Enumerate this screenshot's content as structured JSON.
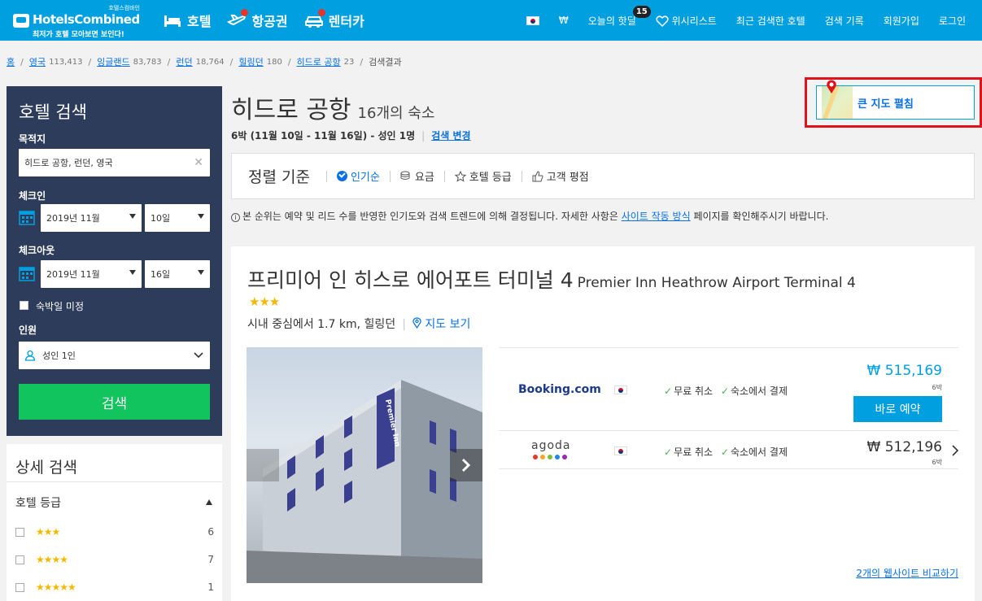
{
  "header": {
    "logo_tag": "호텔스컴바인",
    "logo_name": "HotelsCombined",
    "logo_slogan": "최저가 호텔 모아보면 보인다!",
    "nav": [
      {
        "label": "호텔",
        "icon": "bed-icon"
      },
      {
        "label": "항공권",
        "icon": "plane-icon"
      },
      {
        "label": "렌터카",
        "icon": "car-icon"
      }
    ],
    "currency": "₩",
    "deals_label": "오늘의 핫딜",
    "deals_count": "15",
    "wishlist": "위시리스트",
    "recent": "최근 검색한 호텔",
    "history": "검색 기록",
    "signup": "회원가입",
    "login": "로그인"
  },
  "breadcrumb": [
    {
      "label": "홈",
      "count": ""
    },
    {
      "label": "영국",
      "count": "113,413"
    },
    {
      "label": "잉글랜드",
      "count": "83,783"
    },
    {
      "label": "런던",
      "count": "18,764"
    },
    {
      "label": "힐링던",
      "count": "180"
    },
    {
      "label": "히드로 공항",
      "count": "23"
    }
  ],
  "breadcrumb_current": "검색결과",
  "search_panel": {
    "title": "호텔 검색",
    "destination_label": "목적지",
    "destination_value": "히드로 공항, 런던, 영국",
    "checkin_label": "체크인",
    "checkin_month": "2019년 11월",
    "checkin_day": "10일",
    "checkout_label": "체크아웃",
    "checkout_month": "2019년 11월",
    "checkout_day": "16일",
    "undecided_label": "숙박일 미정",
    "guests_label": "인원",
    "guests_value": "성인 1인",
    "search_button": "검색"
  },
  "detail_panel": {
    "title": "상세 검색",
    "star_section": "호텔 등급",
    "star_filters": [
      {
        "stars": "★★★",
        "count": "6"
      },
      {
        "stars": "★★★★",
        "count": "7"
      },
      {
        "stars": "★★★★★",
        "count": "1"
      }
    ]
  },
  "results": {
    "title": "히드로 공항",
    "count_label": "16개의 숙소",
    "trip_summary": "6박 (11월 10일 - 11월 16일) - 성인 1명",
    "change_search": "검색 변경",
    "map_button": "큰 지도 펼침"
  },
  "sort": {
    "label": "정렬 기준",
    "options": [
      {
        "label": "인기순",
        "icon": "check-circle-icon",
        "active": true
      },
      {
        "label": "요금",
        "icon": "coins-icon"
      },
      {
        "label": "호텔 등급",
        "icon": "star-outline-icon"
      },
      {
        "label": "고객 평점",
        "icon": "thumbs-up-icon"
      }
    ]
  },
  "notice": {
    "text_before": "본 순위는 예약 및 리드 수를 반영한 인기도와 검색 트렌드에 의해 결정됩니다. 자세한 사항은 ",
    "link": "사이트 작동 방식",
    "text_after": " 페이지를 확인해주시기 바랍니다."
  },
  "hotel": {
    "name_ko": "프리미어 인 히스로 에어포트 터미널 4",
    "name_en": "Premier Inn Heathrow Airport Terminal 4",
    "stars": "★★★",
    "distance": "시내 중심에서 1.7 km, 힐링던",
    "map_link": "지도 보기",
    "photo_sign": "Premier Inn",
    "deals": [
      {
        "provider": "Booking.com",
        "perk1": "무료 취소",
        "perk2": "숙소에서 결제",
        "price": "₩ 515,169",
        "nights": "6박",
        "button": "바로 예약"
      },
      {
        "provider": "agoda",
        "perk1": "무료 취소",
        "perk2": "숙소에서 결제",
        "price": "₩ 512,196",
        "nights": "6박"
      }
    ],
    "compare_link": "2개의 웹사이트 비교하기"
  },
  "colors": {
    "brand": "#00a0e0",
    "panel": "#2d3c5a",
    "search_green": "#12c45d",
    "highlight_red": "#e0121a"
  }
}
